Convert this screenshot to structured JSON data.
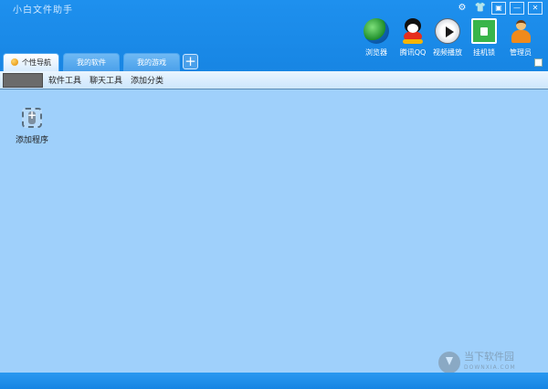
{
  "window": {
    "title": "小白文件助手"
  },
  "system_buttons": [
    "⚙",
    "👕",
    "▣",
    "—",
    "✕"
  ],
  "quick_launch": [
    {
      "id": "browser",
      "label": "浏览器",
      "icon": "globe-icon"
    },
    {
      "id": "qq",
      "label": "腾讯QQ",
      "icon": "qq-penguin-icon"
    },
    {
      "id": "video",
      "label": "视频播放",
      "icon": "play-icon"
    },
    {
      "id": "lock",
      "label": "挂机锁",
      "icon": "lock-icon"
    },
    {
      "id": "admin",
      "label": "管理员",
      "icon": "user-icon"
    }
  ],
  "tabs": [
    {
      "label": "个性导航",
      "active": true
    },
    {
      "label": "我的软件",
      "active": false
    },
    {
      "label": "我的游戏",
      "active": false
    }
  ],
  "tab_add": "+",
  "categories": {
    "items": [
      "软件工具",
      "聊天工具",
      "添加分类"
    ]
  },
  "programs": [
    {
      "label": "添加程序",
      "icon": "add-program-icon"
    }
  ],
  "watermark": {
    "name": "当下软件园",
    "domain": "DOWNXIA.COM"
  },
  "colors": {
    "header": "#1a8be6",
    "content": "#9fd0fb"
  }
}
